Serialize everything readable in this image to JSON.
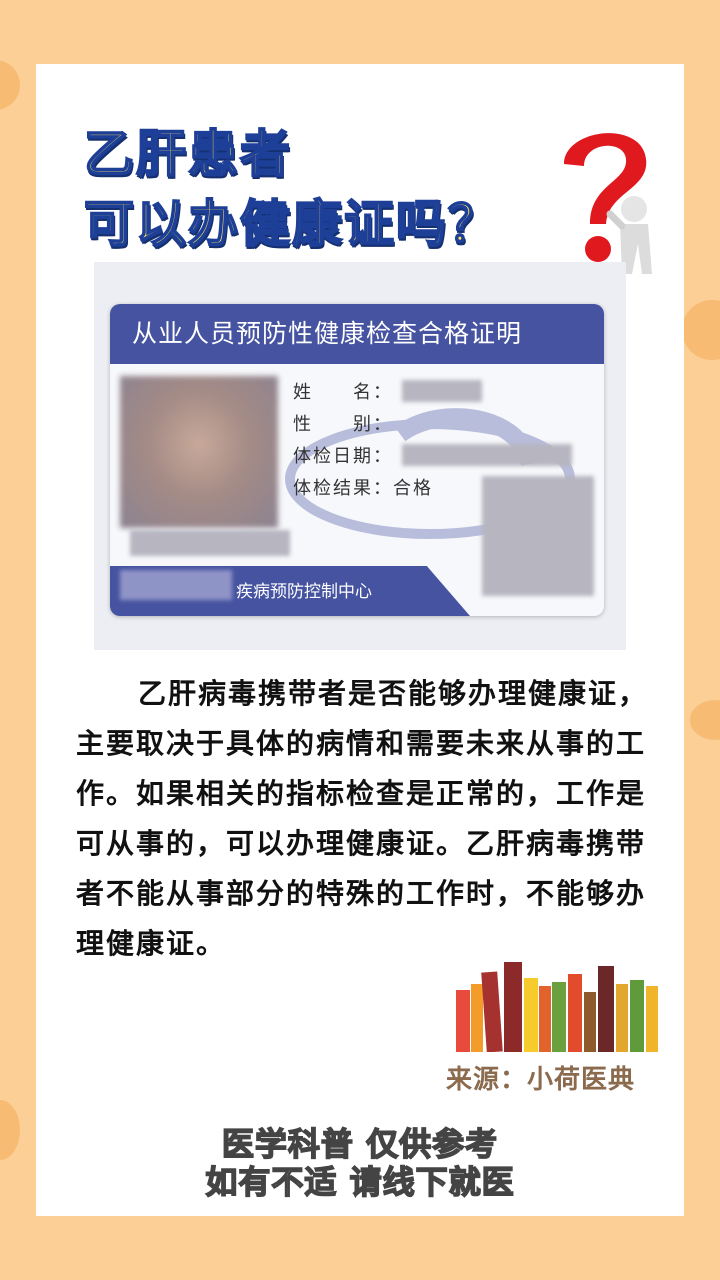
{
  "title": {
    "line1": "乙肝患者",
    "line2": "可以办健康证吗？"
  },
  "id_card": {
    "header": "从业人员预防性健康检查合格证明",
    "fields": [
      {
        "label": "姓　　名："
      },
      {
        "label": "性　　别："
      },
      {
        "label": "体检日期："
      },
      {
        "label": "体检结果：合格"
      }
    ],
    "footer": "疾病预防控制中心"
  },
  "body": "乙肝病毒携带者是否能够办理健康证，主要取决于具体的病情和需要未来从事的工作。如果相关的指标检查是正常的，工作是可从事的，可以办理健康证。乙肝病毒携带者不能从事部分的特殊的工作时，不能够办理健康证。",
  "source": "来源：小荷医典",
  "footer": {
    "line1": "医学科普 仅供参考",
    "line2": "如有不适 请线下就医"
  },
  "colors": {
    "card_blue": "#4653a0",
    "title_yellow": "#ffe35a",
    "background": "#fbcf95"
  }
}
